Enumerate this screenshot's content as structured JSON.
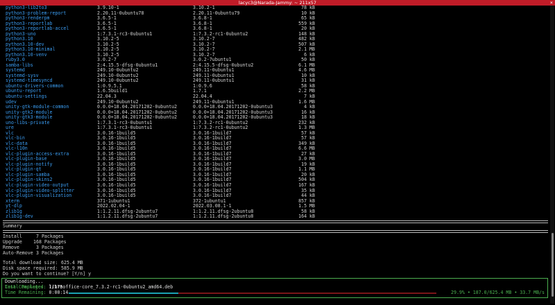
{
  "window": {
    "title": "lacyc3@Narada-Jammy: ~ 211x57",
    "close": "×"
  },
  "packages": [
    {
      "name": "python3-lib2to3",
      "old": "3.9.10-1",
      "new": "3.10.2-1",
      "size": "78 kB"
    },
    {
      "name": "python3-problem-report",
      "old": "2.20.11-0ubuntu78",
      "new": "2.20.11-0ubuntu79",
      "size": "10 kB"
    },
    {
      "name": "python3-renderpm",
      "old": "3.6.5-1",
      "new": "3.6.8-1",
      "size": "65 kB"
    },
    {
      "name": "python3-reportlab",
      "old": "3.6.5-1",
      "new": "3.6.8-1",
      "size": "559 kB"
    },
    {
      "name": "python3-reportlab-accel",
      "old": "3.6.5-1",
      "new": "3.6.8-1",
      "size": "20 kB"
    },
    {
      "name": "python3-uno",
      "old": "1:7.3.1-rc3-0ubuntu1",
      "new": "1:7.3.2-rc1-0ubuntu2",
      "size": "148 kB"
    },
    {
      "name": "python3.10",
      "old": "3.10.2-5",
      "new": "3.10.2-7",
      "size": "482 kB"
    },
    {
      "name": "python3.10-dev",
      "old": "3.10.2-5",
      "new": "3.10.2-7",
      "size": "507 kB"
    },
    {
      "name": "python3.10-minimal",
      "old": "3.10.2-5",
      "new": "3.10.2-7",
      "size": "2.1 MB"
    },
    {
      "name": "python3.10-venv",
      "old": "3.10.2-5",
      "new": "3.10.2-7",
      "size": "6 kB"
    },
    {
      "name": "ruby3.0",
      "old": "3.0.2-7",
      "new": "3.0.2-7ubuntu1",
      "size": "50 kB"
    },
    {
      "name": "samba-libs",
      "old": "2:4.15.5-dfsg-0ubuntu1",
      "new": "2:4.15.5-dfsg-0ubuntu2",
      "size": "6.1 MB"
    },
    {
      "name": "systemd",
      "old": "249.10-0ubuntu2",
      "new": "249.11-0ubuntu1",
      "size": "4.6 MB"
    },
    {
      "name": "systemd-sysv",
      "old": "249.10-0ubuntu2",
      "new": "249.11-0ubuntu1",
      "size": "10 kB"
    },
    {
      "name": "systemd-timesyncd",
      "old": "249.10-0ubuntu2",
      "new": "249.11-0ubuntu1",
      "size": "31 kB"
    },
    {
      "name": "ubuntu-drivers-common",
      "old": "1:0.9.5.1",
      "new": "1:0.9.6",
      "size": "58 kB"
    },
    {
      "name": "ubuntu-report",
      "old": "1.6.5build1",
      "new": "1.7.1",
      "size": "2.2 MB"
    },
    {
      "name": "ubuntu-settings",
      "old": "22.04.3",
      "new": "22.04.4",
      "size": "7 kB"
    },
    {
      "name": "udev",
      "old": "249.10-0ubuntu2",
      "new": "249.11-0ubuntu1",
      "size": "1.6 MB"
    },
    {
      "name": "unity-gtk-module-common",
      "old": "0.0.0+18.04.20171202-0ubuntu2",
      "new": "0.0.0+18.04.20171202-0ubuntu3",
      "size": "4 kB"
    },
    {
      "name": "unity-gtk2-module",
      "old": "0.0.0+18.04.20171202-0ubuntu2",
      "new": "0.0.0+18.04.20171202-0ubuntu3",
      "size": "16 kB"
    },
    {
      "name": "unity-gtk3-module",
      "old": "0.0.0+18.04.20171202-0ubuntu2",
      "new": "0.0.0+18.04.20171202-0ubuntu3",
      "size": "18 kB"
    },
    {
      "name": "uno-libs-private",
      "old": "1:7.3.1-rc3-0ubuntu1",
      "new": "1:7.3.2-rc1-0ubuntu2",
      "size": "232 kB"
    },
    {
      "name": "ure",
      "old": "1:7.3.1-rc3-0ubuntu1",
      "new": "1:7.3.2-rc1-0ubuntu2",
      "size": "1.3 MB"
    },
    {
      "name": "vlc",
      "old": "3.0.16-1build5",
      "new": "3.0.16-1build7",
      "size": "57 kB"
    },
    {
      "name": "vlc-bin",
      "old": "3.0.16-1build5",
      "new": "3.0.16-1build7",
      "size": "57 kB"
    },
    {
      "name": "vlc-data",
      "old": "3.0.16-1build5",
      "new": "3.0.16-1build7",
      "size": "349 kB"
    },
    {
      "name": "vlc-l10n",
      "old": "3.0.16-1build5",
      "new": "3.0.16-1build7",
      "size": "6.6 MB"
    },
    {
      "name": "vlc-plugin-access-extra",
      "old": "3.0.16-1build5",
      "new": "3.0.16-1build7",
      "size": "27 kB"
    },
    {
      "name": "vlc-plugin-base",
      "old": "3.0.16-1build5",
      "new": "3.0.16-1build7",
      "size": "3.0 MB"
    },
    {
      "name": "vlc-plugin-notify",
      "old": "3.0.16-1build5",
      "new": "3.0.16-1build7",
      "size": "19 kB"
    },
    {
      "name": "vlc-plugin-qt",
      "old": "3.0.16-1build5",
      "new": "3.0.16-1build7",
      "size": "1.1 MB"
    },
    {
      "name": "vlc-plugin-samba",
      "old": "3.0.16-1build5",
      "new": "3.0.16-1build7",
      "size": "20 kB"
    },
    {
      "name": "vlc-plugin-skins2",
      "old": "3.0.16-1build5",
      "new": "3.0.16-1build7",
      "size": "504 kB"
    },
    {
      "name": "vlc-plugin-video-output",
      "old": "3.0.16-1build5",
      "new": "3.0.16-1build7",
      "size": "167 kB"
    },
    {
      "name": "vlc-plugin-video-splitter",
      "old": "3.0.16-1build5",
      "new": "3.0.16-1build7",
      "size": "35 kB"
    },
    {
      "name": "vlc-plugin-visualization",
      "old": "3.0.16-1build5",
      "new": "3.0.16-1build7",
      "size": "44 kB"
    },
    {
      "name": "xterm",
      "old": "371-1ubuntu1",
      "new": "372-1ubuntu1",
      "size": "857 kB"
    },
    {
      "name": "yt-dlp",
      "old": "2022.02.04-1",
      "new": "2022.03.08.1-1",
      "size": "1.5 MB"
    },
    {
      "name": "zlib1g",
      "old": "1:1.2.11.dfsg-2ubuntu7",
      "new": "1:1.2.11.dfsg-2ubuntu8",
      "size": "58 kB"
    },
    {
      "name": "zlib1g-dev",
      "old": "1:1.2.11.dfsg-2ubuntu7",
      "new": "1:1.2.11.dfsg-2ubuntu8",
      "size": "164 kB"
    }
  ],
  "summary": {
    "heading": "Summary",
    "counts": [
      {
        "label": "Install",
        "value": "7 Packages"
      },
      {
        "label": "Upgrade",
        "value": "168 Packages"
      },
      {
        "label": "Remove",
        "value": "3 Packages"
      },
      {
        "label": "Auto-Remove",
        "value": "3 Packages"
      }
    ],
    "download_label": "Total download size:",
    "download_value": "625.4 MB",
    "disk_label": "Disk space required:",
    "disk_value": "585.9 MB",
    "prompt": "Do you want to continue? [Y/n] y"
  },
  "progress": {
    "title": "Downloading...",
    "total_label": "Total Packages:",
    "total_value": "1/175",
    "last_label": "Last Completed:",
    "last_value": "libreoffice-core_7.3.2-rc1-0ubuntu2_amd64.deb",
    "time_label": "Time Remaining:",
    "time_value": "0:00:14",
    "stats": "29.9% • 187.0/625.4 MB • 33.7 MB/s",
    "fraction": 0.299,
    "colors": {
      "done": "#1aa3b3",
      "remaining": "#7a1518",
      "accent": "#4caf50",
      "package": "#3b9df2"
    }
  }
}
